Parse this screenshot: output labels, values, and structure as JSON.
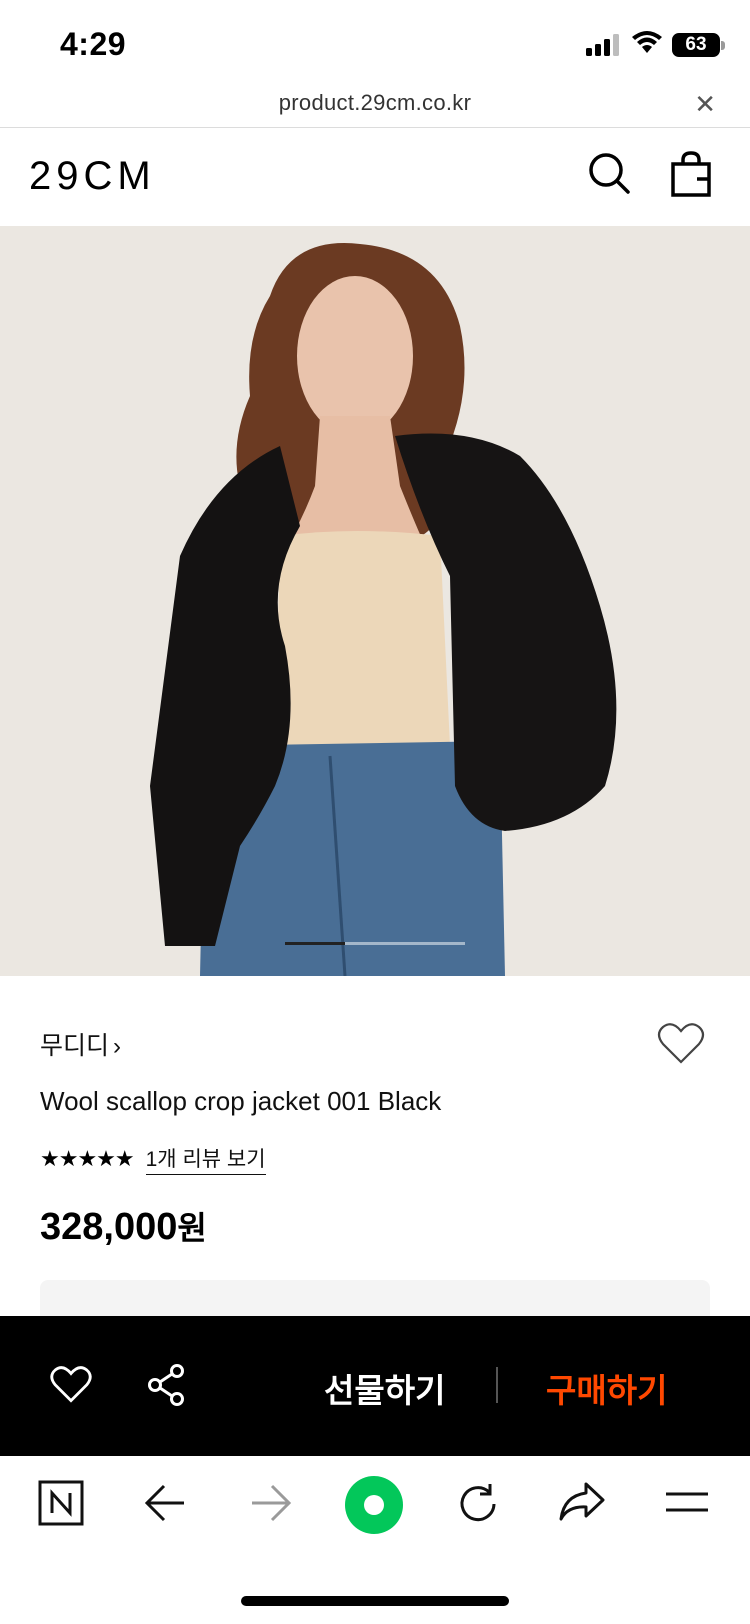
{
  "status_bar": {
    "time": "4:29",
    "battery": "63"
  },
  "browser": {
    "url": "product.29cm.co.kr",
    "close_icon": "close-icon"
  },
  "header": {
    "logo": "29CM",
    "search_icon": "search-icon",
    "bag_icon": "shopping-bag-icon"
  },
  "hero": {
    "image_desc": "model-wearing-black-fur-crop-jacket",
    "indicator_position": "1 of 3"
  },
  "product": {
    "brand": "무디디",
    "brand_chevron": "›",
    "name": "Wool scallop crop jacket 001 Black",
    "stars": "★★★★★",
    "rating": 5,
    "review_link": "1개 리뷰 보기",
    "price": "328,000",
    "price_unit": "원"
  },
  "action_bar": {
    "gift_label": "선물하기",
    "buy_label": "구매하기",
    "buy_color": "#ff4800"
  },
  "toolbar": {
    "items": [
      "naver-n-icon",
      "back-arrow-icon",
      "forward-arrow-icon",
      "green-dot-icon",
      "reload-icon",
      "share-arrow-icon",
      "menu-icon"
    ]
  },
  "colors": {
    "accent": "#ff4800",
    "action_bg": "#000000",
    "green": "#03c75a"
  }
}
